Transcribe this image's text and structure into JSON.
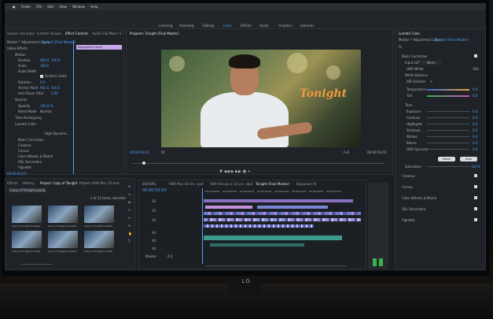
{
  "menubar": [
    "Finder",
    "File",
    "Edit",
    "View",
    "Window",
    "Help"
  ],
  "workspaces": [
    {
      "label": "Learning",
      "active": false
    },
    {
      "label": "Assembly",
      "active": false
    },
    {
      "label": "Editing",
      "active": false
    },
    {
      "label": "Color",
      "active": true
    },
    {
      "label": "Effects",
      "active": false
    },
    {
      "label": "Audio",
      "active": false
    },
    {
      "label": "Graphics",
      "active": false
    },
    {
      "label": "Libraries",
      "active": false
    }
  ],
  "source_panel": {
    "tabs": [
      "Source: (no clips)",
      "Lumetri Scopes",
      "Effect Controls",
      "Audio Clip Mixer: S"
    ],
    "header": "Master * Adjustment Layer",
    "clip": "Tonight (Final Master)",
    "adjustment_label": "Adjustment Layer",
    "section": "Video Effects",
    "rows": [
      "Motion",
      "Position",
      "Scale",
      "Scale Width",
      "Rotation",
      "Anchor Point",
      "Anti-flicker Filter",
      "Opacity",
      "Opacity",
      "Blend Mode",
      "Time Remapping",
      "Lumetri Color",
      "High Dynamic...",
      "Basic Correction",
      "Creative",
      "Curves",
      "Color Wheels & Match",
      "HSL Secondary",
      "Vignette"
    ],
    "values": [
      "960.0",
      "540.0",
      "100.0",
      "0.0",
      "960.0",
      "540.0",
      "0.00",
      "100.0 %",
      "Normal"
    ],
    "uniform_scale": "Uniform Scale",
    "timecode": "00:00:03:03"
  },
  "program_monitor": {
    "title": "Program: Tonight (Final Master)",
    "overlay_text": "Tonight",
    "timecode_left": "00:00:03:03",
    "timecode_right": "00:00:59:03",
    "fit": "Fit",
    "quality": "Full"
  },
  "project_panel": {
    "tabs": [
      "Effects",
      "History",
      "Project: Copy of Tonight",
      "Project: HDR Plus 10 sect"
    ],
    "file": "Copy of Tonight.prproj",
    "count": "1 of 31 items selected",
    "thumbs": [
      "Copy of Tonight (Linked)",
      "Copy of Tonight (Linked)",
      "Copy of Tonight (Linked)",
      "Copy of Tonight (Linked)",
      "Copy of Tonight (Linked)",
      "Copy of Tonight (Linked)"
    ]
  },
  "timeline": {
    "tabs": [
      "BIGADRL",
      "HDR Plus 10 sec. spot",
      "HDR Version 2 10 sec. spot",
      "Tonight (Final Master)",
      "Sequence 01"
    ],
    "timecode": "00:00:03:03",
    "tracks": [
      "V3",
      "V2",
      "V1",
      "A1",
      "A2",
      "A3",
      "Master"
    ],
    "master_value": "0.0",
    "ruler": [
      "00;00;00;00",
      "00;00;04;23",
      "00;00;09;23",
      "00;00;14;23",
      "00;00;19;23",
      "00;00;24;23",
      "00;00;29;23",
      "00;00;34;23"
    ]
  },
  "lumetri": {
    "title": "Lumetri Color",
    "header": "Master * Adjustment Layer",
    "clip": "Tonight (Final Master)",
    "fx": "fx",
    "section": "Basic Correction",
    "input_lut_label": "Input LUT",
    "input_lut_value": "None",
    "hdr_white": "HDR White",
    "hdr_value": "100",
    "white_balance": "White Balance",
    "wb_selector": "WB Selector",
    "temperature": "Temperature",
    "tint": "Tint",
    "tone": "Tone",
    "tone_rows": [
      "Exposure",
      "Contrast",
      "Highlights",
      "Shadows",
      "Whites",
      "Blacks",
      "HDR Specular"
    ],
    "tone_values": [
      "0.0",
      "0.0",
      "0.0",
      "0.0",
      "0.0",
      "0.0",
      "0.0"
    ],
    "reset": "Reset",
    "auto": "Auto",
    "saturation": "Saturation",
    "saturation_value": "100.0",
    "sections": [
      "Creative",
      "Curves",
      "Color Wheels & Match",
      "HSL Secondary",
      "Vignette"
    ],
    "temperature_value": "0.0",
    "tint_value": "0.0"
  },
  "monitor_logo": "LG"
}
